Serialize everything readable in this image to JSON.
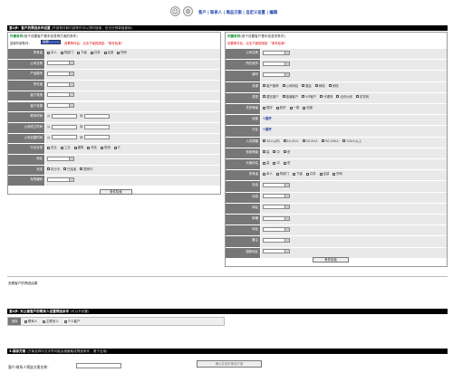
{
  "top": {
    "links": "客户 | 联系人 | 商品方案 | 自定义设置 | 编辑"
  },
  "step1": {
    "bar": "第1步：客户的筛选条件设置",
    "bar_note": "(外部条件和内部条件可以同时使用，也可分别单独使用)",
    "left_title": "外部条件",
    "left_sub": "(用于设置客户基本信息等方面的条件)",
    "left_select_label": "选择外部条件：",
    "left_select_value": "全部",
    "left_hint": "设置条件后，点击下面的按钮：\"条件检索\"",
    "left_rows": [
      {
        "label": "所有者",
        "opts": [
          "本人",
          "同部门",
          "下级",
          "共享",
          "全部",
          "所有"
        ]
      },
      {
        "label": "公司名称"
      },
      {
        "label": "产品模块"
      },
      {
        "label": "所在省"
      },
      {
        "label": "客户类别"
      },
      {
        "label": "客户来源"
      },
      {
        "label": "联系时间",
        "from": "从",
        "to": "到"
      },
      {
        "label": "公司成立时间",
        "from": "从",
        "to": "到"
      },
      {
        "label": "公司创建时间",
        "from": "从",
        "to": "到"
      },
      {
        "label": "行业分类",
        "opts": [
          "农业",
          "工业",
          "建筑",
          "商业",
          "物流",
          "IT"
        ]
      },
      {
        "label": "地区"
      },
      {
        "label": "状态",
        "opts": [
          "执行中",
          "已结束",
          "暂停中"
        ]
      },
      {
        "label": "标签编码"
      }
    ],
    "left_button": "条件检索",
    "right_title": "内部条件",
    "right_sub": "(用于设置客户基本信息的条件)",
    "right_hint": "设置条件后，点击下面的按钮：\"条件检索\"",
    "right_rows": [
      {
        "label": "公司名称"
      },
      {
        "label": "所在城市"
      },
      {
        "label": "编号"
      },
      {
        "label": "来源",
        "opts": [
          "客户推荐",
          "公司网站",
          "展会",
          "网络",
          "其他"
        ]
      },
      {
        "label": "类型",
        "opts": [
          "潜在客户",
          "普通客户",
          "VIP客户",
          "代理商",
          "合作伙伴",
          "供货商"
        ]
      },
      {
        "label": "关系等级",
        "opts": [
          "很好",
          "较好",
          "一般",
          "较差"
        ]
      },
      {
        "label": "经营",
        "link": "+展开"
      },
      {
        "label": "行业",
        "link": "+展开"
      },
      {
        "label": "人员规模",
        "opts": [
          "10人以内",
          "10-20人",
          "20-50人",
          "50-200人",
          "200人以上"
        ]
      },
      {
        "label": "信用等级",
        "opts": [
          "高",
          "中",
          "低"
        ]
      },
      {
        "label": "价值评估",
        "opts": [
          "高",
          "中",
          "低"
        ]
      },
      {
        "label": "所有者",
        "opts": [
          "本人",
          "同部门",
          "下级",
          "共享",
          "全部",
          "所有"
        ]
      },
      {
        "label": "电话"
      },
      {
        "label": "传真"
      },
      {
        "label": "网址"
      },
      {
        "label": "邮编"
      },
      {
        "label": "地址"
      },
      {
        "label": "备注"
      },
      {
        "label": "国家地区"
      }
    ],
    "right_button": "条件检索",
    "result_text": "查看客户的筛选结果"
  },
  "step2": {
    "bar": "第2步. 对上面客户的联系人设置筛选条件",
    "bar_note": "(可以不设置)",
    "label": "选择",
    "opts": [
      "联系人",
      "主联系人",
      "个人客户"
    ]
  },
  "step3": {
    "bar": "3.保存方案",
    "bar_note": "(方案名称中文字符可能会被截取成筛选条件，便于应用)",
    "label": "客户/联系人筛选方案名称：",
    "button": "确认并保存筛选方案"
  }
}
